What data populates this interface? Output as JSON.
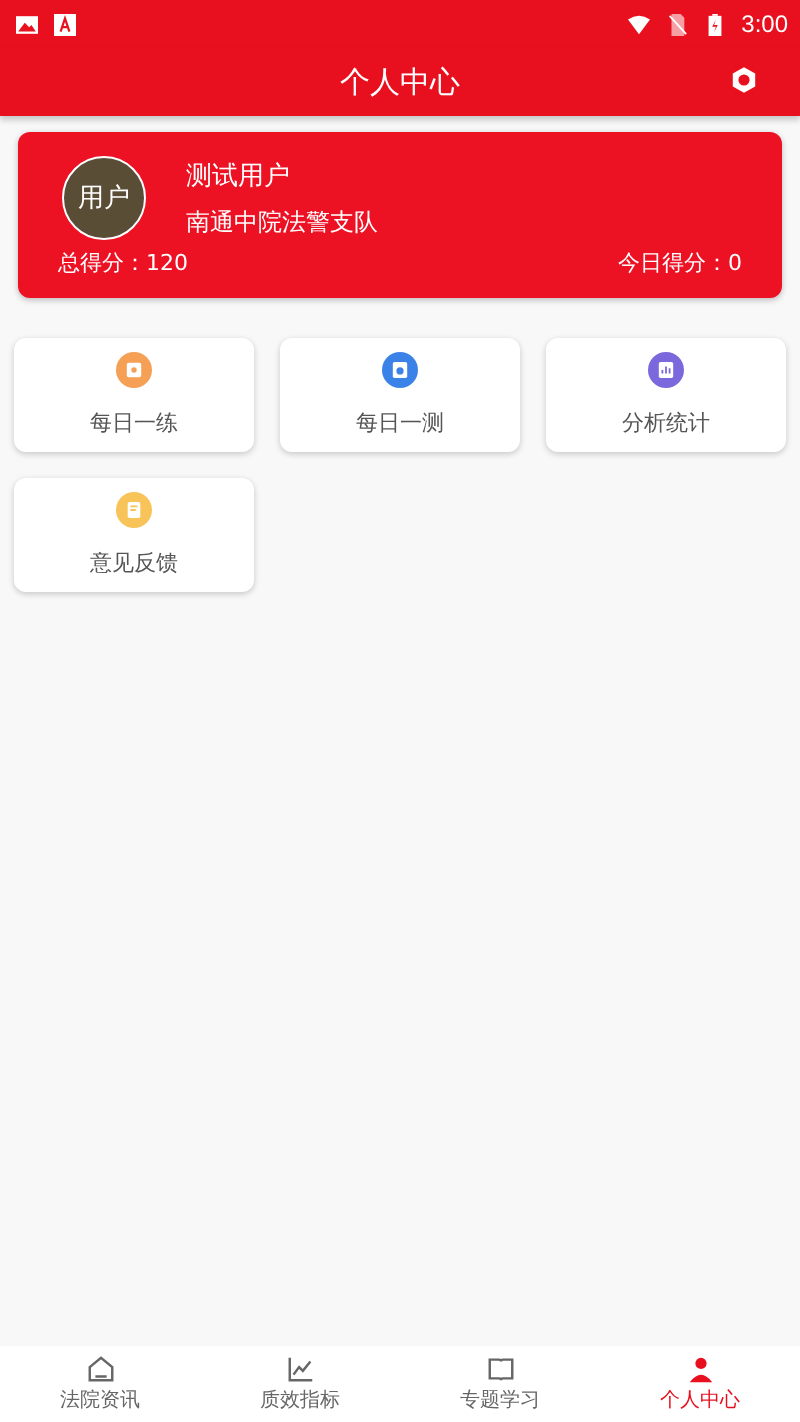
{
  "status_bar": {
    "time": "3:00"
  },
  "app_bar": {
    "title": "个人中心"
  },
  "profile": {
    "avatar": "用户",
    "name": "测试用户",
    "unit": "南通中院法警支队",
    "total_score": "总得分：120",
    "today_score": "今日得分：0"
  },
  "features": [
    {
      "label": "每日一练",
      "color": "#f5a055",
      "kind": "practice"
    },
    {
      "label": "每日一测",
      "color": "#3b82e8",
      "kind": "test"
    },
    {
      "label": "分析统计",
      "color": "#7b68dc",
      "kind": "stats"
    },
    {
      "label": "意见反馈",
      "color": "#f8c45a",
      "kind": "feedback"
    }
  ],
  "tabs": [
    {
      "label": "法院资讯",
      "kind": "home",
      "selected": false
    },
    {
      "label": "质效指标",
      "kind": "chart",
      "selected": false
    },
    {
      "label": "专题学习",
      "kind": "book",
      "selected": false
    },
    {
      "label": "个人中心",
      "kind": "person",
      "selected": true
    }
  ]
}
